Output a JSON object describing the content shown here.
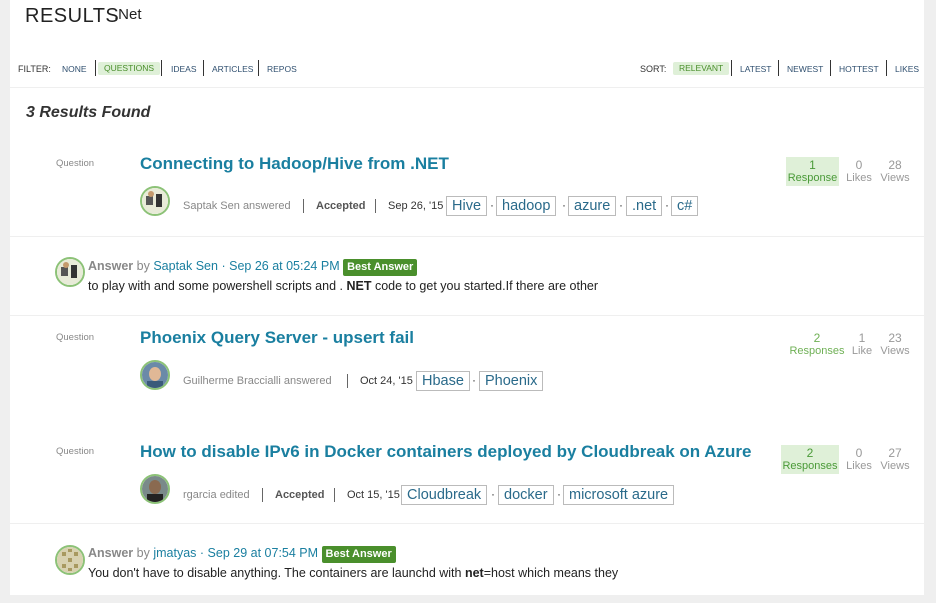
{
  "header": {
    "title": "RESULTS",
    "subtitle": ".Net",
    "filter_label": "FILTER:",
    "filters": [
      "NONE",
      "QUESTIONS",
      "IDEAS",
      "ARTICLES",
      "REPOS"
    ],
    "active_filter": "QUESTIONS",
    "sort_label": "SORT:",
    "sorts": [
      "RELEVANT",
      "LATEST",
      "NEWEST",
      "HOTTEST",
      "LIKES"
    ],
    "active_sort": "RELEVANT"
  },
  "results_count": "3 Results Found",
  "questions": [
    {
      "type": "Question",
      "title": "Connecting to Hadoop/Hive from .NET",
      "author": "Saptak Sen",
      "action": "answered",
      "status": "Accepted",
      "date": "Sep 26, '15",
      "tags": [
        "Hive",
        "hadoop",
        "azure",
        ".net",
        "c#"
      ],
      "responses": {
        "n": "1",
        "label": "Response"
      },
      "likes": {
        "n": "0",
        "label": "Likes"
      },
      "views": {
        "n": "28",
        "label": "Views"
      }
    },
    {
      "type": "Question",
      "title": "Phoenix Query Server - upsert fail",
      "author": "Guilherme Braccialli",
      "action": "answered",
      "status": "",
      "date": "Oct 24, '15",
      "tags": [
        "Hbase",
        "Phoenix"
      ],
      "responses": {
        "n": "2",
        "label": "Responses"
      },
      "likes": {
        "n": "1",
        "label": "Like"
      },
      "views": {
        "n": "23",
        "label": "Views"
      }
    },
    {
      "type": "Question",
      "title": "How to disable IPv6 in Docker containers deployed by Cloudbreak on Azure",
      "author": "rgarcia",
      "action": "edited",
      "status": "Accepted",
      "date": "Oct 15, '15",
      "tags": [
        "Cloudbreak",
        "docker",
        "microsoft azure"
      ],
      "responses": {
        "n": "2",
        "label": "Responses"
      },
      "likes": {
        "n": "0",
        "label": "Likes"
      },
      "views": {
        "n": "27",
        "label": "Views"
      }
    }
  ],
  "answers": [
    {
      "label": "Answer",
      "by": "by",
      "author": "Saptak Sen",
      "sep": "·",
      "date": "Sep 26 at 05:24 PM",
      "badge": "Best Answer",
      "text_before": "to play with and some powershell scripts and .",
      "text_bold": "NET",
      "text_after": " code to get you started.If there are other"
    },
    {
      "label": "Answer",
      "by": "by",
      "author": "jmatyas",
      "sep": "·",
      "date": "Sep 29 at 07:54 PM",
      "badge": "Best Answer",
      "text_before": "You don't have to disable anything. The containers are launchd with ",
      "text_bold": "net",
      "text_after": "=host which means they"
    }
  ],
  "tag_separator": "·",
  "colors": {
    "accent_blue": "#1a7fa0",
    "accent_green": "#4a8f2c",
    "green_bg": "#dff0d8"
  }
}
